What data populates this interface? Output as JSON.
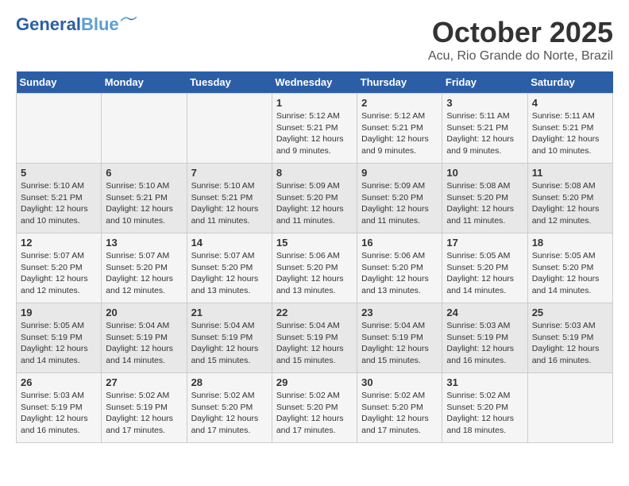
{
  "logo": {
    "line1": "General",
    "line2": "Blue"
  },
  "title": "October 2025",
  "location": "Acu, Rio Grande do Norte, Brazil",
  "weekdays": [
    "Sunday",
    "Monday",
    "Tuesday",
    "Wednesday",
    "Thursday",
    "Friday",
    "Saturday"
  ],
  "weeks": [
    [
      {
        "day": "",
        "info": ""
      },
      {
        "day": "",
        "info": ""
      },
      {
        "day": "",
        "info": ""
      },
      {
        "day": "1",
        "info": "Sunrise: 5:12 AM\nSunset: 5:21 PM\nDaylight: 12 hours and 9 minutes."
      },
      {
        "day": "2",
        "info": "Sunrise: 5:12 AM\nSunset: 5:21 PM\nDaylight: 12 hours and 9 minutes."
      },
      {
        "day": "3",
        "info": "Sunrise: 5:11 AM\nSunset: 5:21 PM\nDaylight: 12 hours and 9 minutes."
      },
      {
        "day": "4",
        "info": "Sunrise: 5:11 AM\nSunset: 5:21 PM\nDaylight: 12 hours and 10 minutes."
      }
    ],
    [
      {
        "day": "5",
        "info": "Sunrise: 5:10 AM\nSunset: 5:21 PM\nDaylight: 12 hours and 10 minutes."
      },
      {
        "day": "6",
        "info": "Sunrise: 5:10 AM\nSunset: 5:21 PM\nDaylight: 12 hours and 10 minutes."
      },
      {
        "day": "7",
        "info": "Sunrise: 5:10 AM\nSunset: 5:21 PM\nDaylight: 12 hours and 11 minutes."
      },
      {
        "day": "8",
        "info": "Sunrise: 5:09 AM\nSunset: 5:20 PM\nDaylight: 12 hours and 11 minutes."
      },
      {
        "day": "9",
        "info": "Sunrise: 5:09 AM\nSunset: 5:20 PM\nDaylight: 12 hours and 11 minutes."
      },
      {
        "day": "10",
        "info": "Sunrise: 5:08 AM\nSunset: 5:20 PM\nDaylight: 12 hours and 11 minutes."
      },
      {
        "day": "11",
        "info": "Sunrise: 5:08 AM\nSunset: 5:20 PM\nDaylight: 12 hours and 12 minutes."
      }
    ],
    [
      {
        "day": "12",
        "info": "Sunrise: 5:07 AM\nSunset: 5:20 PM\nDaylight: 12 hours and 12 minutes."
      },
      {
        "day": "13",
        "info": "Sunrise: 5:07 AM\nSunset: 5:20 PM\nDaylight: 12 hours and 12 minutes."
      },
      {
        "day": "14",
        "info": "Sunrise: 5:07 AM\nSunset: 5:20 PM\nDaylight: 12 hours and 13 minutes."
      },
      {
        "day": "15",
        "info": "Sunrise: 5:06 AM\nSunset: 5:20 PM\nDaylight: 12 hours and 13 minutes."
      },
      {
        "day": "16",
        "info": "Sunrise: 5:06 AM\nSunset: 5:20 PM\nDaylight: 12 hours and 13 minutes."
      },
      {
        "day": "17",
        "info": "Sunrise: 5:05 AM\nSunset: 5:20 PM\nDaylight: 12 hours and 14 minutes."
      },
      {
        "day": "18",
        "info": "Sunrise: 5:05 AM\nSunset: 5:20 PM\nDaylight: 12 hours and 14 minutes."
      }
    ],
    [
      {
        "day": "19",
        "info": "Sunrise: 5:05 AM\nSunset: 5:19 PM\nDaylight: 12 hours and 14 minutes."
      },
      {
        "day": "20",
        "info": "Sunrise: 5:04 AM\nSunset: 5:19 PM\nDaylight: 12 hours and 14 minutes."
      },
      {
        "day": "21",
        "info": "Sunrise: 5:04 AM\nSunset: 5:19 PM\nDaylight: 12 hours and 15 minutes."
      },
      {
        "day": "22",
        "info": "Sunrise: 5:04 AM\nSunset: 5:19 PM\nDaylight: 12 hours and 15 minutes."
      },
      {
        "day": "23",
        "info": "Sunrise: 5:04 AM\nSunset: 5:19 PM\nDaylight: 12 hours and 15 minutes."
      },
      {
        "day": "24",
        "info": "Sunrise: 5:03 AM\nSunset: 5:19 PM\nDaylight: 12 hours and 16 minutes."
      },
      {
        "day": "25",
        "info": "Sunrise: 5:03 AM\nSunset: 5:19 PM\nDaylight: 12 hours and 16 minutes."
      }
    ],
    [
      {
        "day": "26",
        "info": "Sunrise: 5:03 AM\nSunset: 5:19 PM\nDaylight: 12 hours and 16 minutes."
      },
      {
        "day": "27",
        "info": "Sunrise: 5:02 AM\nSunset: 5:19 PM\nDaylight: 12 hours and 17 minutes."
      },
      {
        "day": "28",
        "info": "Sunrise: 5:02 AM\nSunset: 5:20 PM\nDaylight: 12 hours and 17 minutes."
      },
      {
        "day": "29",
        "info": "Sunrise: 5:02 AM\nSunset: 5:20 PM\nDaylight: 12 hours and 17 minutes."
      },
      {
        "day": "30",
        "info": "Sunrise: 5:02 AM\nSunset: 5:20 PM\nDaylight: 12 hours and 17 minutes."
      },
      {
        "day": "31",
        "info": "Sunrise: 5:02 AM\nSunset: 5:20 PM\nDaylight: 12 hours and 18 minutes."
      },
      {
        "day": "",
        "info": ""
      }
    ]
  ]
}
